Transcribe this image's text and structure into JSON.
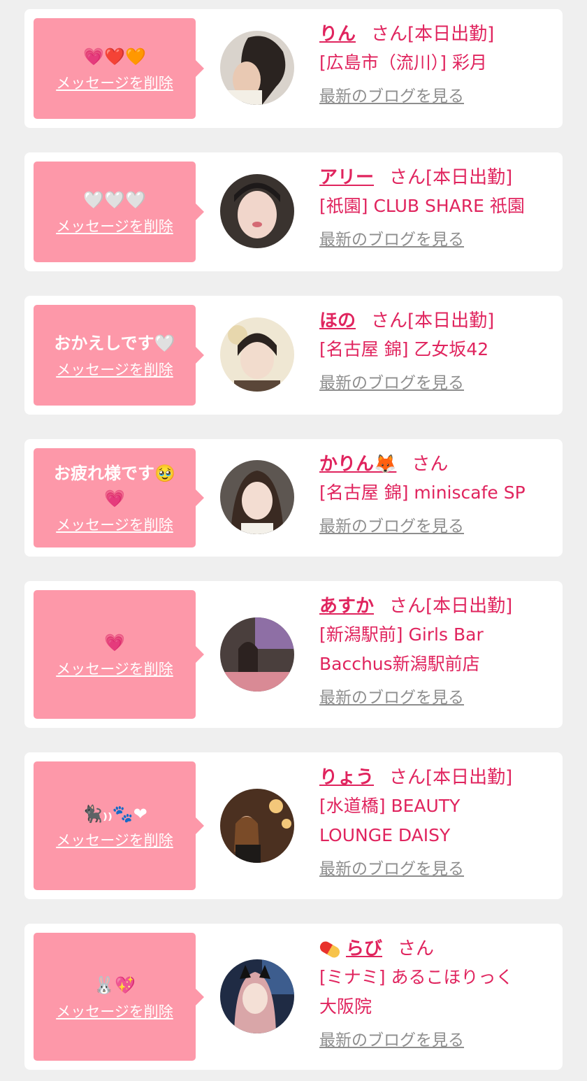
{
  "delete_label": "メッセージを削除",
  "blog_label": "最新のブログを見る",
  "san_label": "さん",
  "colors": {
    "page_bg": "#efefef",
    "card_bg": "#ffffff",
    "bubble_bg": "#fd98a9",
    "accent_text": "#e0245e",
    "link_gray": "#8e8e8e"
  },
  "cards": [
    {
      "message": "💗❤️🧡",
      "name": "りん",
      "status": "[本日出勤]",
      "shop_lines": [
        "[広島市（流川）] 彩月"
      ]
    },
    {
      "message": "🤍🤍🤍",
      "name": "アリー",
      "status": "[本日出勤]",
      "shop_lines": [
        "[祇園] CLUB SHARE 祇園"
      ]
    },
    {
      "message": "おかえしです🤍",
      "name": "ほの",
      "status": "[本日出勤]",
      "shop_lines": [
        "[名古屋 錦] 乙女坂42"
      ]
    },
    {
      "message": "お疲れ様です🥹💗",
      "name": "かりん🦊",
      "status": "",
      "shop_lines": [
        "[名古屋 錦] miniscafe SP"
      ]
    },
    {
      "message": "💗",
      "name": "あすか",
      "status": "[本日出勤]",
      "shop_lines": [
        "[新潟駅前] Girls Bar",
        "Bacchus新潟駅前店"
      ]
    },
    {
      "message": "🐈‍⬛₎₎🐾❤",
      "name": "りょう",
      "status": "[本日出勤]",
      "shop_lines": [
        "[水道橋] BEAUTY",
        "LOUNGE DAISY"
      ]
    },
    {
      "message": "🐰💖",
      "name": "らび",
      "name_icon": "pill-icon",
      "status": "",
      "shop_lines": [
        "[ミナミ] あるこほりっく",
        "大阪院"
      ]
    }
  ]
}
